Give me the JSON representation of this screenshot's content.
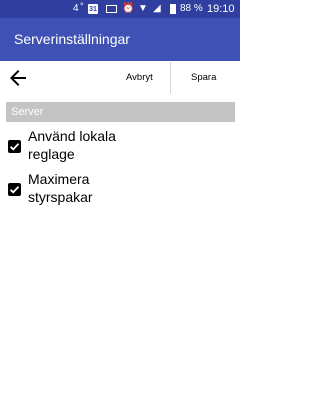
{
  "statusbar": {
    "network": "4",
    "calendar_day": "31",
    "battery_percent": "88 %",
    "time": "19:10"
  },
  "appbar": {
    "title": "Serverinställningar"
  },
  "toolbar": {
    "cancel_label": "Avbryt",
    "save_label": "Spara"
  },
  "section": {
    "title": "Server"
  },
  "options": [
    {
      "line1": "Använd lokala",
      "line2": "reglage",
      "checked": true
    },
    {
      "line1": "Maximera",
      "line2": "styrspakar",
      "checked": true
    }
  ],
  "colors": {
    "statusbar": "#303f9f",
    "appbar": "#3f51b5",
    "section_header": "#c4c4c4"
  }
}
